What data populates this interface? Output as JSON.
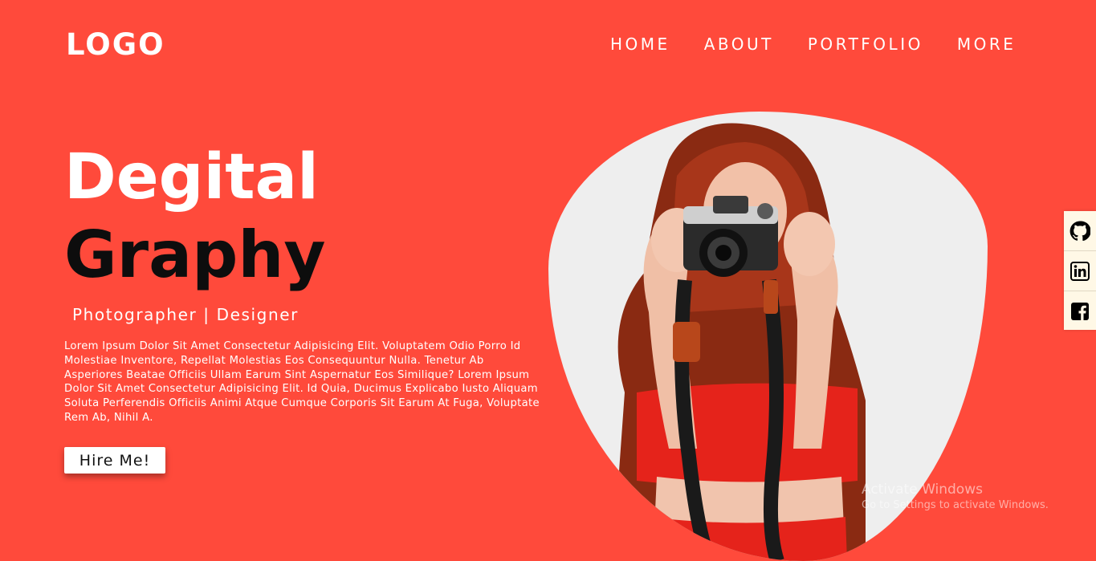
{
  "header": {
    "logo": "LOGO",
    "nav": [
      {
        "label": "HOME"
      },
      {
        "label": "ABOUT"
      },
      {
        "label": "PORTFOLIO"
      },
      {
        "label": "MORE"
      }
    ]
  },
  "hero": {
    "title_line1": "Degital",
    "title_line2": "Graphy",
    "subtitle": "Photographer | Designer",
    "description": "Lorem Ipsum Dolor Sit Amet Consectetur Adipisicing Elit. Voluptatem Odio Porro Id Molestiae Inventore, Repellat Molestias Eos Consequuntur Nulla. Tenetur Ab Asperiores Beatae Officiis Ullam Earum Sint Aspernatur Eos Similique? Lorem Ipsum Dolor Sit Amet Consectetur Adipisicing Elit. Id Quia, Ducimus Explicabo Iusto Aliquam Soluta Perferendis Officiis Animi Atque Cumque Corporis Sit Earum At Fuga, Voluptate Rem Ab, Nihil A.",
    "cta_label": "Hire Me!"
  },
  "social": [
    {
      "icon": "github-icon"
    },
    {
      "icon": "linkedin-icon"
    },
    {
      "icon": "facebook-icon"
    }
  ],
  "watermark": {
    "line1": "Activate Windows",
    "line2": "Go to Settings to activate Windows."
  },
  "colors": {
    "background": "#ff4a3b",
    "title_dark": "#0d0d0d",
    "blob": "#eeeeee",
    "social_bar": "#fff8e6"
  }
}
